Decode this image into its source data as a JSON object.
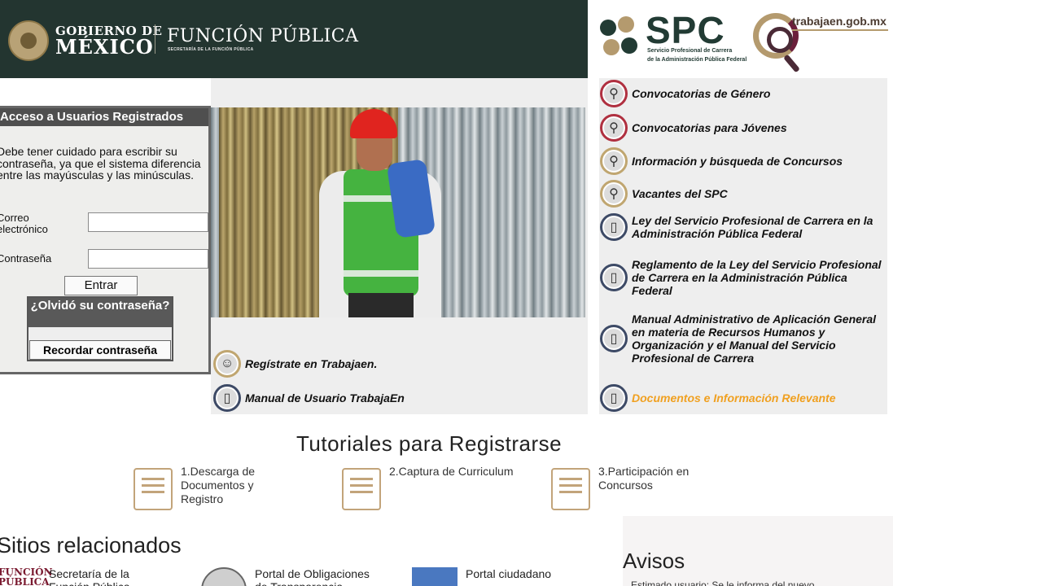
{
  "header": {
    "gov_line1": "GOBIERNO DE",
    "gov_line2": "MÉXICO",
    "fp_title": "FUNCIÓN PÚBLICA",
    "fp_subtitle": "SECRETARÍA DE LA FUNCIÓN PÚBLICA",
    "spc_title": "SPC",
    "spc_sub1": "Servicio Profesional de Carrera",
    "spc_sub2": "de la Administración Pública Federal",
    "trabajaen_url": "trabajaen.gob.mx"
  },
  "login": {
    "title": "Acceso a Usuarios Registrados",
    "note": "Debe tener cuidado para escribir su contraseña, ya que el sistema diferencia entre las mayúsculas y las minúsculas.",
    "email_label": "Correo electrónico",
    "email_value": "",
    "password_label": "Contraseña",
    "password_value": "",
    "submit_label": "Entrar",
    "forgot_title": "¿Olvidó su contraseña?",
    "remind_label": "Recordar contraseña"
  },
  "register_links": [
    {
      "label": "Regístrate en Trabajaen.",
      "icon": "user-icon"
    },
    {
      "label": "Manual de Usuario TrabajaEn",
      "icon": "document-icon"
    }
  ],
  "menu": [
    {
      "label": "Convocatorias de Género",
      "icon": "search-icon",
      "ring": "red"
    },
    {
      "label": "Convocatorias para Jóvenes",
      "icon": "search-icon",
      "ring": "red"
    },
    {
      "label": "Información y búsqueda de Concursos",
      "icon": "search-icon",
      "ring": "gold"
    },
    {
      "label": "Vacantes del SPC",
      "icon": "search-icon",
      "ring": "gold"
    },
    {
      "label": "Ley del Servicio Profesional de Carrera en la Administración Pública Federal",
      "icon": "document-icon",
      "ring": "navy"
    },
    {
      "label": "Reglamento de la Ley del Servicio Profesional de Carrera en la Administración Pública Federal",
      "icon": "document-icon",
      "ring": "navy"
    },
    {
      "label": "Manual Administrativo de Aplicación General en materia de Recursos Humanos y Organización y el Manual del Servicio Profesional de Carrera",
      "icon": "document-icon",
      "ring": "navy"
    },
    {
      "label": "Documentos e Información Relevante",
      "icon": "document-icon",
      "ring": "navy",
      "color": "#f0a020"
    }
  ],
  "tutorials": {
    "title": "Tutoriales para Registrarse",
    "items": [
      {
        "label": "1.Descarga de Documentos y Registro",
        "icon": "laptop-document-icon"
      },
      {
        "label": "2.Captura de Curriculum",
        "icon": "graduation-cap-icon"
      },
      {
        "label": "3.Participación en Concursos",
        "icon": "person-document-icon"
      }
    ]
  },
  "related": {
    "title": "Sitios relacionados",
    "items": [
      {
        "logo": "FUNCIÓN PÚBLICA",
        "label": "Secretaría de la Función Pública"
      },
      {
        "label": "Portal de Obligaciones de Transparencia"
      },
      {
        "label": "Portal ciudadano"
      }
    ]
  },
  "avisos": {
    "title": "Avisos",
    "text": "Estimado usuario: Se le informa del nuevo"
  },
  "colors": {
    "header_bg": "#233530",
    "accent_gold": "#c2a47a",
    "link_orange": "#f0a020",
    "login_header": "#4f4f4f"
  }
}
